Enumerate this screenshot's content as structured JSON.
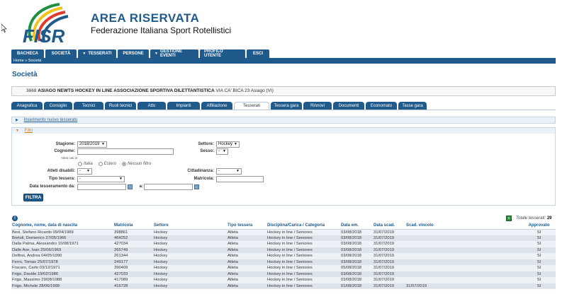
{
  "header": {
    "title": "AREA RISERVATA",
    "subtitle": "Federazione Italiana Sport Rotellistici",
    "logo_text": "FISR"
  },
  "menu": [
    {
      "label": "BACHECA",
      "caret": false,
      "w": 46
    },
    {
      "label": "SOCIETÀ",
      "caret": false,
      "w": 44
    },
    {
      "label": "TESSERATI",
      "caret": true,
      "w": 54
    },
    {
      "label": "PERSONE",
      "caret": false,
      "w": 44
    },
    {
      "label": "GESTIONE EVENTI",
      "caret": true,
      "w": 68
    },
    {
      "label": "PROFILO UTENTE",
      "caret": false,
      "w": 64
    },
    {
      "label": "ESCI",
      "caret": false,
      "w": 32
    }
  ],
  "breadcrumb": "Home » Società",
  "page_title": "Società",
  "society": {
    "code": "3668",
    "name": "ASIAGO NEWTS HOCKEY IN LINE ASSOCIAZIONE SPORTIVA DILETTANTISTICA",
    "address": "VIA CA' BICA 23 Asiago (VI)"
  },
  "tabs": [
    {
      "label": "Anagrafica",
      "w": 44,
      "active": false
    },
    {
      "label": "Consiglio",
      "w": 40,
      "active": false
    },
    {
      "label": "Tecnici",
      "w": 42,
      "active": false
    },
    {
      "label": "Ruoli tecnici",
      "w": 44,
      "active": false
    },
    {
      "label": "Atto",
      "w": 40,
      "active": false
    },
    {
      "label": "Impianti",
      "w": 46,
      "active": false
    },
    {
      "label": "Affiliazione",
      "w": 44,
      "active": false
    },
    {
      "label": "Tesserati",
      "w": 50,
      "active": true
    },
    {
      "label": "Tessera gara",
      "w": 44,
      "active": false
    },
    {
      "label": "Rinnovi",
      "w": 40,
      "active": false
    },
    {
      "label": "Documenti",
      "w": 44,
      "active": false
    },
    {
      "label": "Economato",
      "w": 44,
      "active": false
    },
    {
      "label": "Tasse gara",
      "w": 40,
      "active": false
    }
  ],
  "sections": {
    "insert": "Inserimento nuovo tesserato",
    "filters": "Filtri"
  },
  "filters": {
    "stagione_label": "Stagione:",
    "stagione_value": "2018/2019",
    "settore_label": "Settore:",
    "settore_value": "Hockey",
    "cognome_label": "Cognome:",
    "cognome_value": "",
    "sesso_label": "Sesso:",
    "sesso_value": "-",
    "nati_label": "Atleti nati in:",
    "radio_italia": "Italia",
    "radio_estero": "Estero",
    "radio_nessun": "Nessun filtro",
    "atleti_disabili_label": "Atleti disabili:",
    "atleti_disabili_value": "-",
    "cittadinanza_label": "Cittadinanza:",
    "cittadinanza_value": "-",
    "tipo_tessera_label": "Tipo tessera:",
    "tipo_tessera_value": "-",
    "matricola_label": "Matricola:",
    "matricola_value": "",
    "data_da_label": "Data tesseramento da:",
    "data_a_label": "a:",
    "button": "FILTRA"
  },
  "results": {
    "total_label": "Totale tesserati:",
    "total_value": "29",
    "columns": [
      "Cognome, nome, data di nascita",
      "Matricola",
      "Settore",
      "Tipo tessera",
      "Disciplina/Carica / Categoria",
      "Data em.",
      "Data scad.",
      "Scad. vincolo",
      "Approvato"
    ],
    "rows": [
      [
        "Besi, Stefano Ricardo 09/04/1989",
        "398861",
        "Hockey",
        "Atleta",
        "Hockey in line / Seniores",
        "03/08/2018",
        "31/07/2019",
        "",
        "SI"
      ],
      [
        "Bortoli, Domenico 27/05/1966",
        "464252",
        "Hockey",
        "Atleta",
        "Hockey in line / Seniores",
        "03/08/2018",
        "31/07/2019",
        "",
        "SI"
      ],
      [
        "Dalla Palma, Alessandro 10/08/1971",
        "427034",
        "Hockey",
        "Atleta",
        "Hockey in line / Seniores",
        "03/08/2018",
        "31/07/2019",
        "",
        "SI"
      ],
      [
        "Dalle Ave, Ivan 25/06/1969",
        "265749",
        "Hockey",
        "Atleta",
        "Hockey in line / Seniores",
        "03/08/2018",
        "31/07/2019",
        "",
        "SI"
      ],
      [
        "Delfino, Andrea 04/05/1990",
        "261344",
        "Hockey",
        "Atleta",
        "Hockey in line / Seniores",
        "03/08/2018",
        "31/07/2019",
        "",
        "SI"
      ],
      [
        "Ferro, Tomas 25/07/1978",
        "249177",
        "Hockey",
        "Atleta",
        "Hockey in line / Seniores",
        "03/08/2018",
        "31/07/2019",
        "",
        "SI"
      ],
      [
        "Fracaro, Carlo 03/12/1971",
        "390409",
        "Hockey",
        "Atleta",
        "Hockey in line / Seniores",
        "05/08/2018",
        "31/07/2019",
        "",
        "SI"
      ],
      [
        "Frigo, Davide 19/02/1986",
        "427033",
        "Hockey",
        "Atleta",
        "Hockey in line / Seniores",
        "03/08/2018",
        "31/07/2019",
        "",
        "SI"
      ],
      [
        "Frigo, Massimo 29/08/1988",
        "417089",
        "Hockey",
        "Atleta",
        "Hockey in line / Seniores",
        "03/08/2018",
        "31/07/2019",
        "",
        "SI"
      ],
      [
        "Frigo, Michele 28/06/1999",
        "416728",
        "Hockey",
        "Atleta",
        "Hockey in line / Seniores",
        "01/08/2018",
        "31/07/2019",
        "31/07/2019",
        "SI"
      ]
    ]
  }
}
